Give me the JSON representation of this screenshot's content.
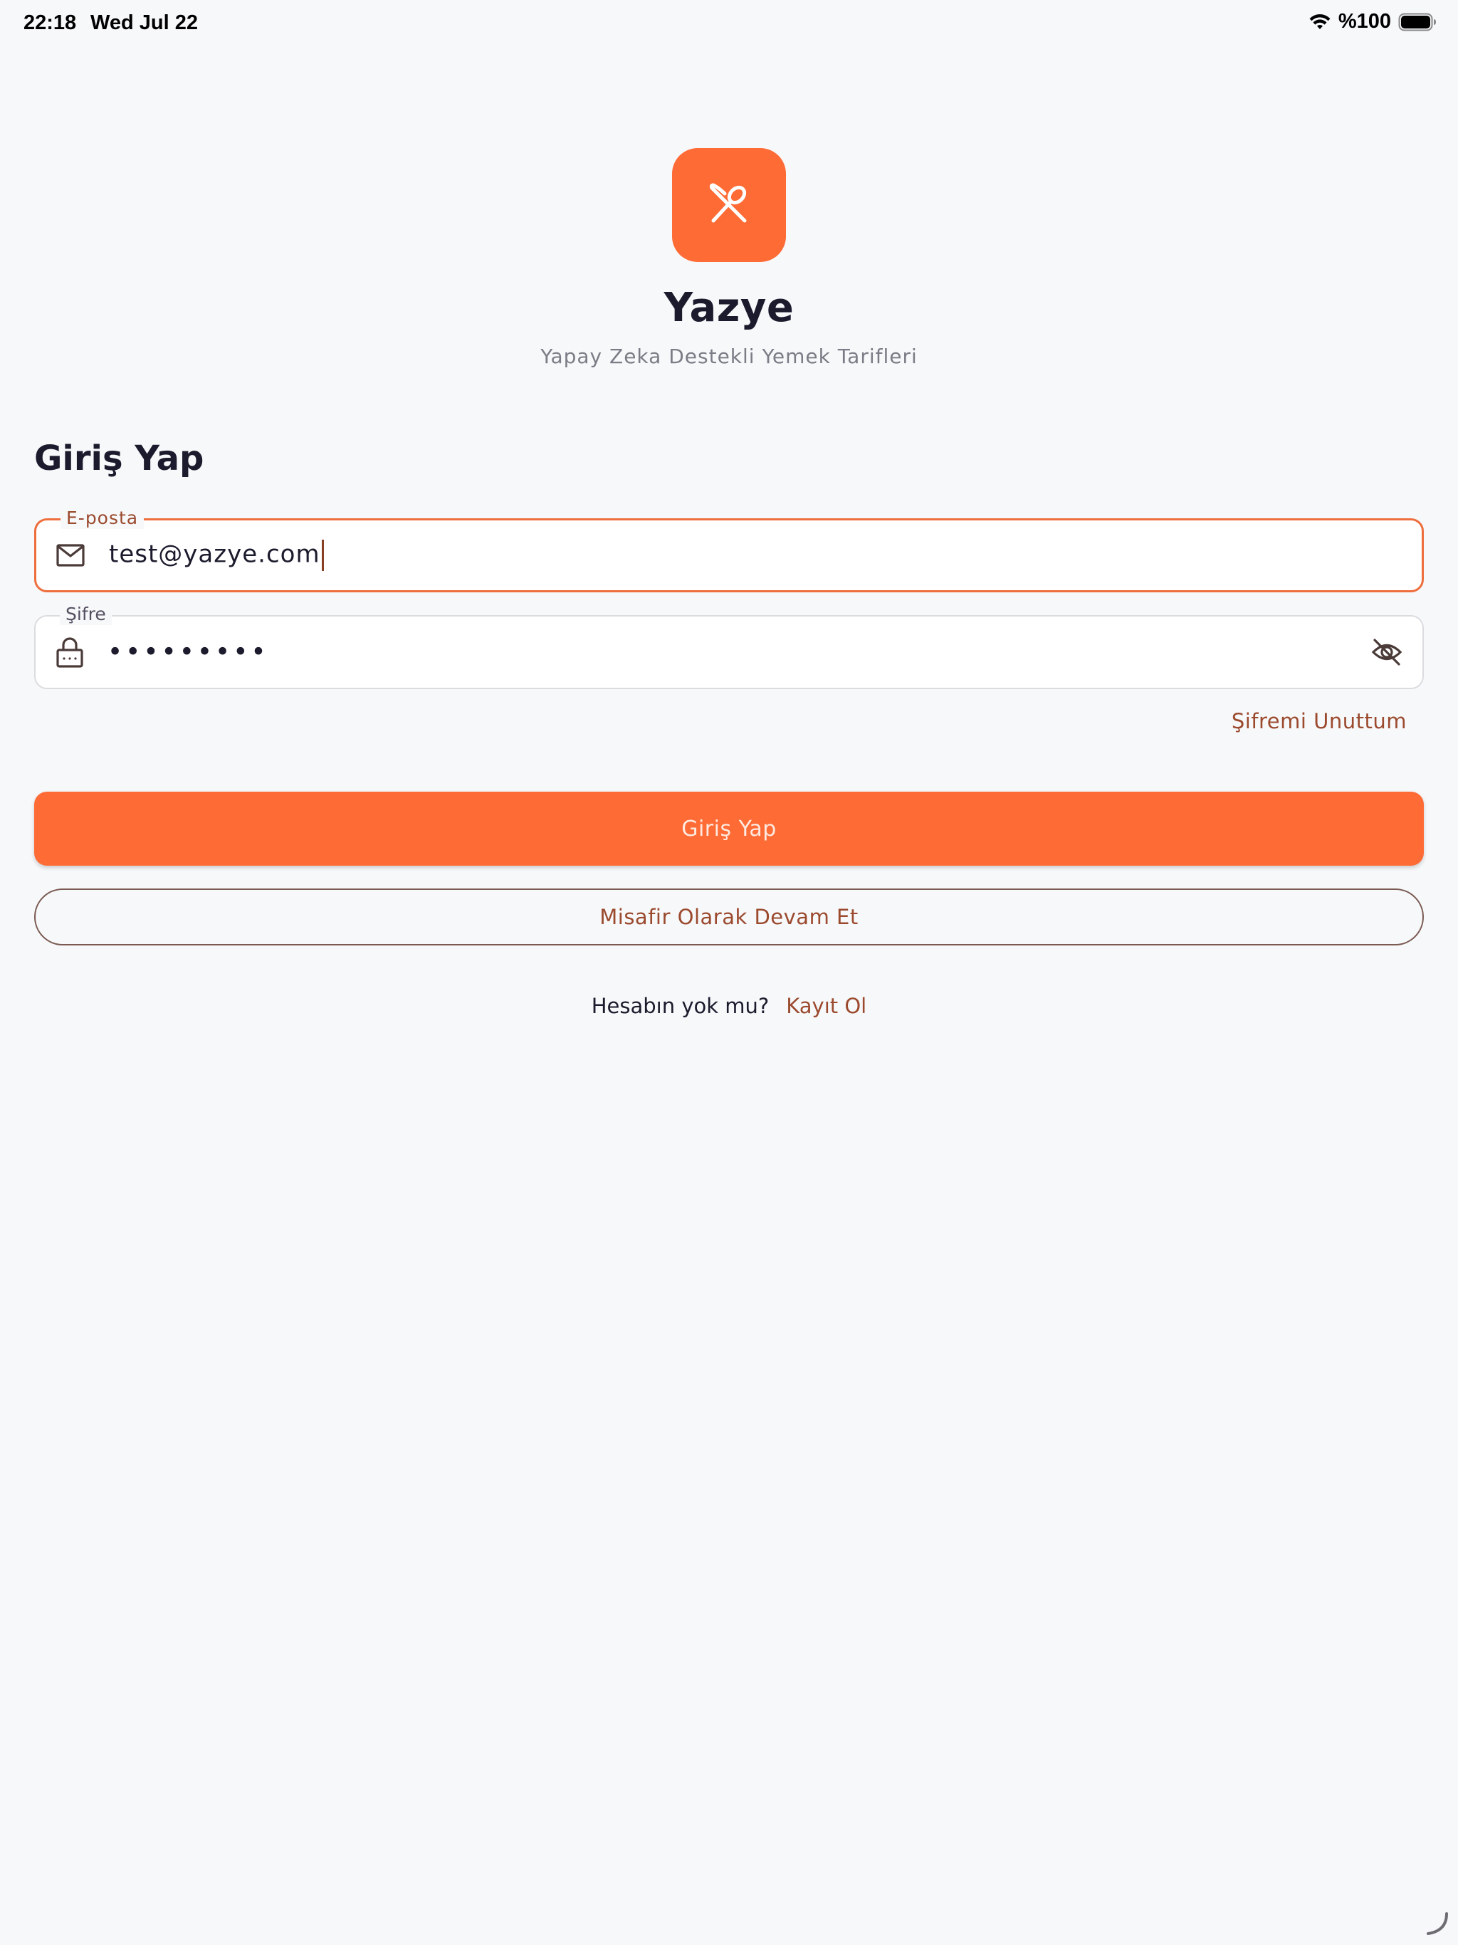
{
  "status_bar": {
    "time": "22:18",
    "date": "Wed Jul 22",
    "battery": "%100",
    "icons": [
      "wifi-icon",
      "battery-icon"
    ]
  },
  "app": {
    "logo_icon": "fork-knife-icon",
    "title": "Yazye",
    "subtitle": "Yapay Zeka Destekli Yemek Tarifleri"
  },
  "login": {
    "heading": "Giriş Yap",
    "email": {
      "label": "E-posta",
      "value": "test@yazye.com",
      "icon": "mail-icon"
    },
    "password": {
      "label": "Şifre",
      "value_masked": "•••••••••",
      "icon": "lock-icon",
      "toggle_icon": "eye-off-icon"
    },
    "forgot_password": "Şifremi Unuttum",
    "submit_label": "Giriş Yap",
    "guest_label": "Misafir Olarak Devam Et",
    "register_prompt": "Hesabın yok mu?",
    "register_link": "Kayıt Ol"
  },
  "colors": {
    "accent": "#ff6b35",
    "link": "#9b4a2e",
    "background": "#f7f8fa"
  }
}
